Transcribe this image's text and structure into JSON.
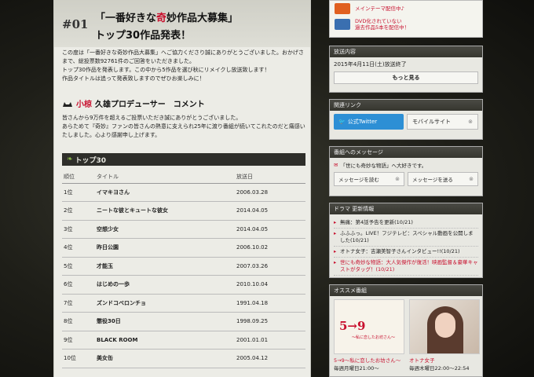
{
  "main": {
    "number": "#01",
    "title_line1_a": "「一番好きな",
    "title_line1_b": "奇",
    "title_line1_c": "妙作品大募集」",
    "title_line2": "トップ30作品発表！",
    "intro": [
      "この度は「一番好きな奇妙作品大募集」へご協力くださり誠にありがとうございました。おかげさまで、総投票数92761件のご回答をいただきました。",
      "トップ30作品を発表します。この中から5作品を選び秋にリメイクし放送致します！",
      "作品タイトルは追って発表致しますのでぜひお楽しみに！"
    ],
    "producer_name_red": "小椋",
    "producer_name_rest": "久雄プロデューサー　コメント",
    "producer_text": [
      "皆さんから9万件を超えるご投票いただき誠にありがとうございました。",
      "あらためて『奇妙』ファンの皆さんの熱意に支えられ25年に渡り番組が続いてこれたのだと痛感いたしました。心より感謝申し上げます。"
    ],
    "top30_label": "トップ30",
    "table_headers": [
      "順位",
      "タイトル",
      "放送日"
    ],
    "rankings": [
      {
        "rank": "1位",
        "title": "イマキヨさん",
        "date": "2006.03.28"
      },
      {
        "rank": "2位",
        "title": "ニートな彼とキュートな彼女",
        "date": "2014.04.05"
      },
      {
        "rank": "3位",
        "title": "空想少女",
        "date": "2014.04.05"
      },
      {
        "rank": "4位",
        "title": "昨日公園",
        "date": "2006.10.02"
      },
      {
        "rank": "5位",
        "title": "才能玉",
        "date": "2007.03.26"
      },
      {
        "rank": "6位",
        "title": "はじめの一歩",
        "date": "2010.10.04"
      },
      {
        "rank": "7位",
        "title": "ズンドコベロンチョ",
        "date": "1991.04.18"
      },
      {
        "rank": "8位",
        "title": "懲役30日",
        "date": "1998.09.25"
      },
      {
        "rank": "9位",
        "title": "BLACK ROOM",
        "date": "2001.01.01"
      },
      {
        "rank": "10位",
        "title": "美女缶",
        "date": "2005.04.12"
      }
    ]
  },
  "sidebar": {
    "promo1": "メインテーマ配信中♪",
    "promo2_l1": "DVD化されていない",
    "promo2_l2": "過去作品5本を配信中！",
    "broadcast_label": "放送内容",
    "broadcast_text": "2015年4月11日(土)放送終了",
    "more_label": "もっと見る",
    "links_label": "関連リンク",
    "twitter_label": "公式Twitter",
    "mobile_label": "モバイルサイト",
    "message_label": "番組へのメッセージ",
    "message_text": "「世にも奇妙な物語」へ大好きです。",
    "read_msg": "メッセージを読む",
    "send_msg": "メッセージを送る",
    "news_label": "ドラマ 更新情報",
    "news": [
      "無痛：第4話予告を更新(10/21)",
      "ふふふっ。LIVE！フジテレビ：スペシャル動画を公開しました(10/21)",
      "オトナ女子：吉瀬美智子さんインタビュー!!(10/21)",
      "世にも奇妙な物語：大人気傑作が復活！映画監督＆豪華キャストがタッグ！(10/21)"
    ],
    "recommend_label": "オススメ番組",
    "rec1_logo": "5→9",
    "rec1_sub": "～私に恋したお坊さん～",
    "rec1_name": "5→9～私に恋したお坊さん～",
    "rec1_time": "毎週月曜日21:00～",
    "rec2_name": "オトナ女子",
    "rec2_time": "毎週木曜日22:00～22:54"
  }
}
